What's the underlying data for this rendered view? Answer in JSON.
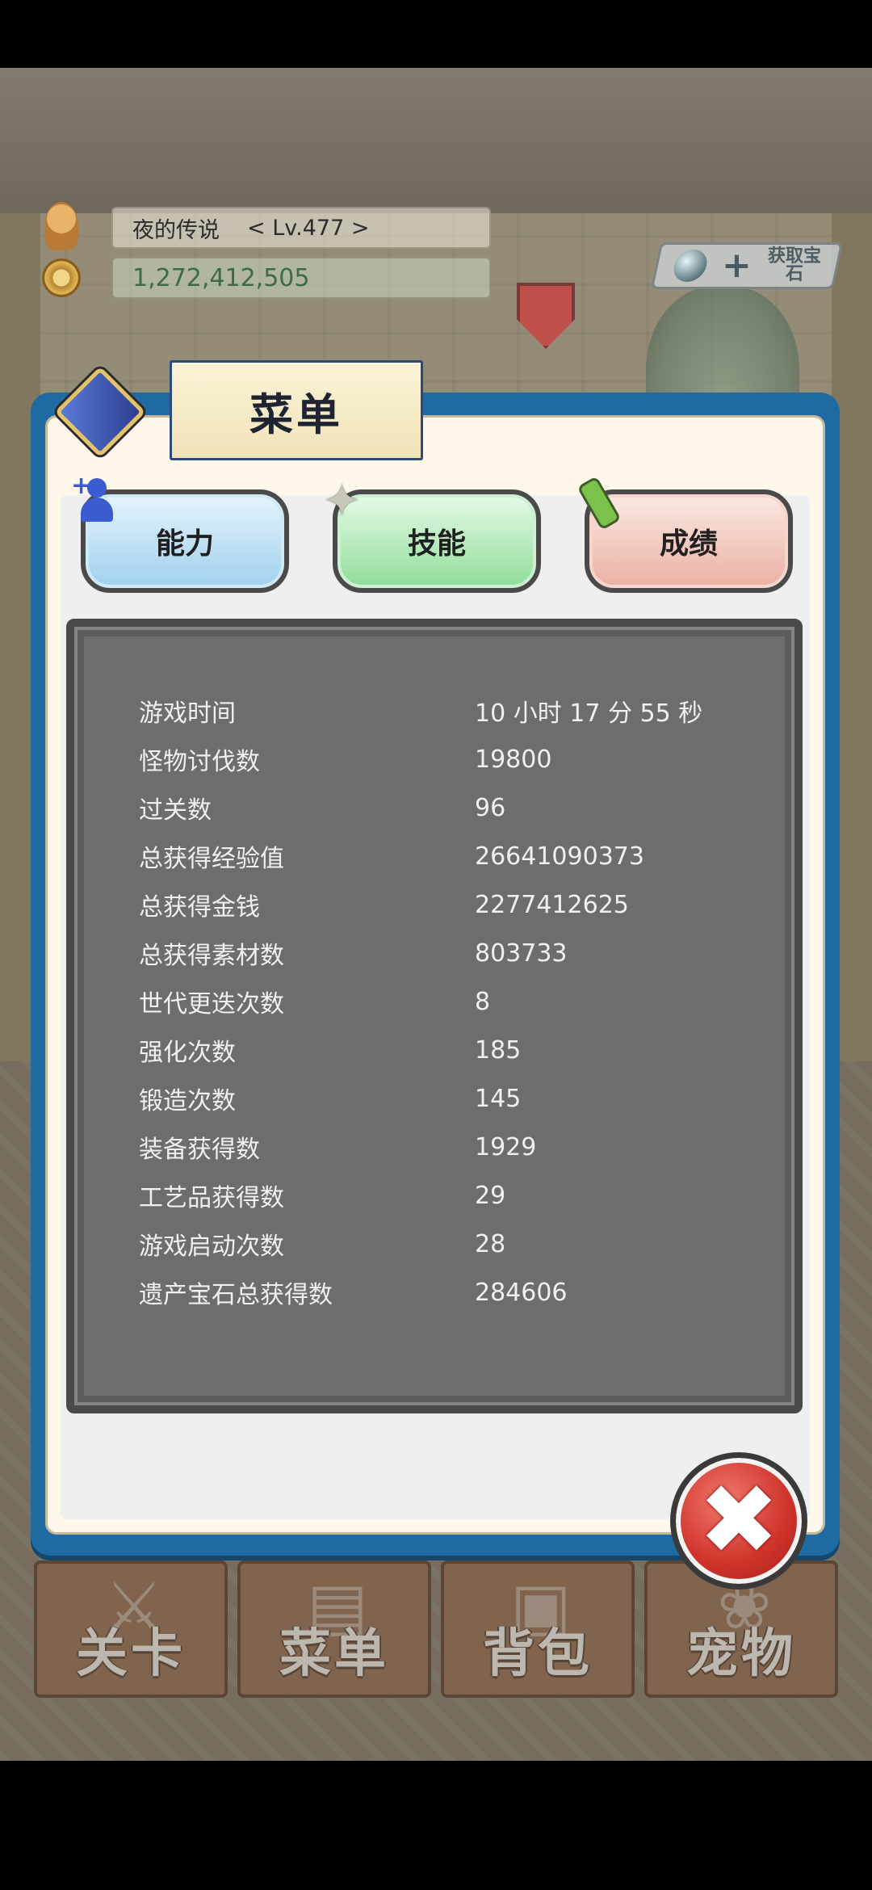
{
  "hud": {
    "player_name": "夜的传说",
    "level": "< Lv.477 >",
    "gold": "1,272,412,505",
    "gem_plus": "+",
    "gem_label": "获取宝石"
  },
  "dialog": {
    "title": "菜单",
    "tabs": [
      {
        "label": "能力"
      },
      {
        "label": "技能"
      },
      {
        "label": "成绩"
      }
    ],
    "stats": [
      {
        "label": "游戏时间",
        "value": "10 小时 17 分 55 秒"
      },
      {
        "label": "怪物讨伐数",
        "value": "19800"
      },
      {
        "label": "过关数",
        "value": "96"
      },
      {
        "label": "总获得经验值",
        "value": "26641090373"
      },
      {
        "label": "总获得金钱",
        "value": "2277412625"
      },
      {
        "label": "总获得素材数",
        "value": "803733"
      },
      {
        "label": "世代更迭次数",
        "value": "8"
      },
      {
        "label": "强化次数",
        "value": "185"
      },
      {
        "label": "锻造次数",
        "value": "145"
      },
      {
        "label": "装备获得数",
        "value": "1929"
      },
      {
        "label": "工艺品获得数",
        "value": "29"
      },
      {
        "label": "游戏启动次数",
        "value": "28"
      },
      {
        "label": "遗产宝石总获得数",
        "value": "284606"
      }
    ],
    "close_symbol": "✖"
  },
  "nav": [
    {
      "label": "关卡",
      "icon": "crossed-swords-icon"
    },
    {
      "label": "菜单",
      "icon": "book-icon"
    },
    {
      "label": "背包",
      "icon": "backpack-icon"
    },
    {
      "label": "宠物",
      "icon": "pet-icon"
    }
  ]
}
